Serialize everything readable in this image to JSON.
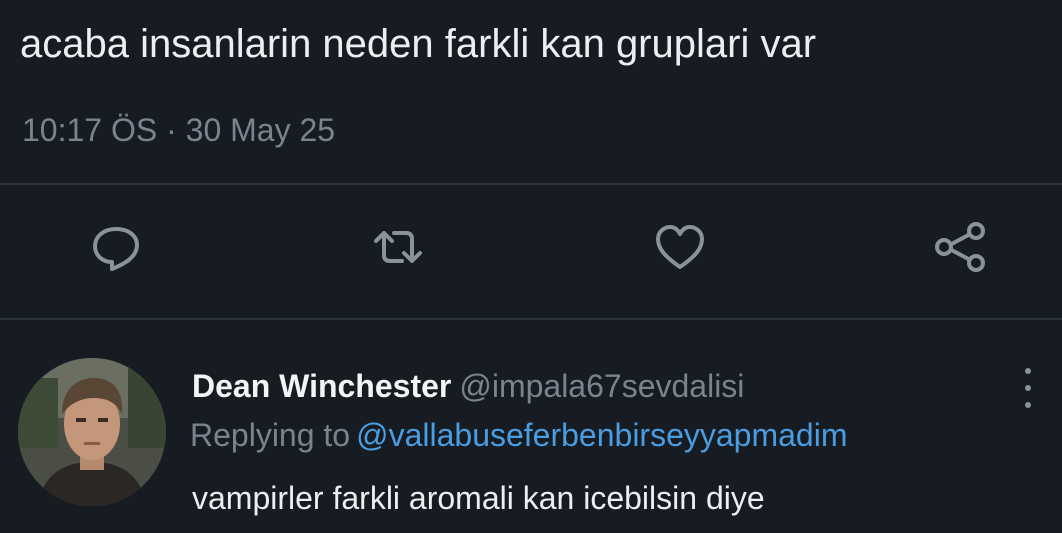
{
  "tweet": {
    "text": "acaba insanlarin neden farkli kan gruplari var",
    "meta": "10:17 ÖS · 30 May 25"
  },
  "actions": {
    "reply_icon": "speech-bubble-icon",
    "retweet_icon": "retweet-arrows-icon",
    "like_icon": "heart-icon",
    "share_icon": "share-nodes-icon"
  },
  "reply": {
    "author_name": "Dean Winchester",
    "author_handle": "@impala67sevdalisi",
    "replying_prefix": "Replying to",
    "replying_handle": "@vallabuseferbenbirseyyapmadim",
    "text": "vampirler farkli aromali kan icebilsin diye",
    "more_icon": "vertical-ellipsis-icon"
  },
  "colors": {
    "background": "#171c23",
    "text": "#eceff2",
    "muted": "#7a848e",
    "link": "#4a9de0",
    "divider": "#2b323b"
  }
}
